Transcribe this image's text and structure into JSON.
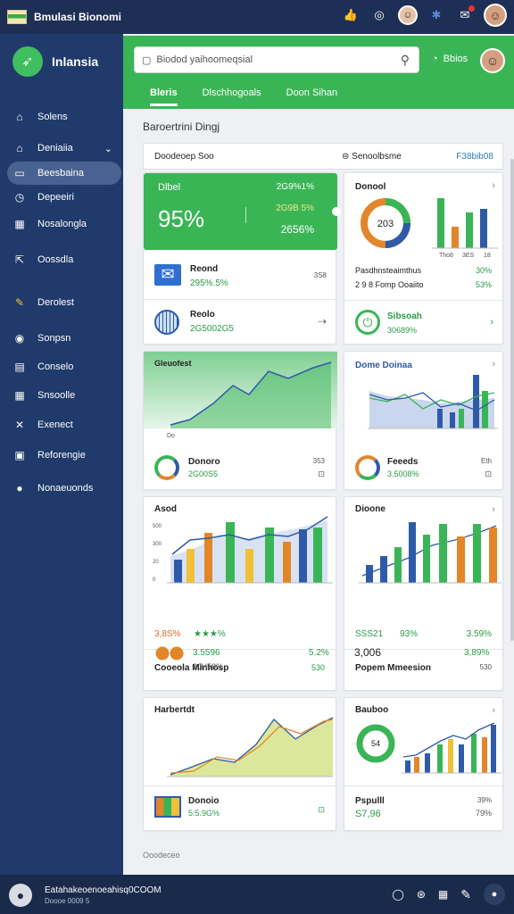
{
  "app": {
    "title": "Bmulasi Bionomi"
  },
  "topbar": {
    "icons": [
      "thumb-icon",
      "settings-icon",
      "avatar",
      "network-icon",
      "notification-icon",
      "avatar"
    ]
  },
  "sidebar": {
    "brand": "Inlansia",
    "items": [
      {
        "label": "Solens",
        "icon": "home-icon"
      },
      {
        "label": "Deniaiia",
        "icon": "chart-icon"
      },
      {
        "label": "Beesbaina",
        "icon": "folder-icon"
      },
      {
        "label": "Depeeiri",
        "icon": "clock-icon"
      },
      {
        "label": "Nosalongla",
        "icon": "grid-icon"
      },
      {
        "label": "Oossdla",
        "icon": "export-icon"
      },
      {
        "label": "Derolest",
        "icon": "pencil-icon"
      },
      {
        "label": "Sonpsn",
        "icon": "target-icon"
      },
      {
        "label": "Conselo",
        "icon": "document-icon"
      },
      {
        "label": "Snsoolle",
        "icon": "grid-icon"
      },
      {
        "label": "Exenect",
        "icon": "tools-icon"
      },
      {
        "label": "Reforengie",
        "icon": "report-icon"
      },
      {
        "label": "Nonaeuonds",
        "icon": "profile-icon"
      }
    ]
  },
  "header": {
    "search_placeholder": "Biodod yaihoomeqsial",
    "status": "Bbios",
    "tabs": [
      "Bleris",
      "Dlschhogoals",
      "Doon Sihan"
    ]
  },
  "main": {
    "section_title": "Baroertrini Dingj",
    "filter": {
      "left": "Doodeoep Soo",
      "mid": "Senoolbsme",
      "right": "F38bib08"
    }
  },
  "cards": {
    "hero": {
      "label": "Dlbel",
      "value": "95%",
      "v1": "2G9%1%",
      "v2": "2G9B 5%",
      "v3": "2656%"
    },
    "donut1": {
      "title": "Donool",
      "center": "203",
      "ticks": [
        "Tho8",
        "3ES",
        "18"
      ],
      "l1": "Pasdhnsteaimthus",
      "l2": "2 9 8 Fomp Ooaiito",
      "p1": "30%",
      "p2": "53%"
    },
    "mail": {
      "title": "Reond",
      "value": "295%.5%",
      "note": "3S8"
    },
    "globe": {
      "title": "Reolo",
      "value": "2G5002G5"
    },
    "green2": {
      "title": "Sibsoah",
      "value": "30689%"
    },
    "area1": {
      "title": "Gleuofest",
      "sub": "Donoro",
      "value": "2G00S5",
      "code": "353",
      "xtick": "Do"
    },
    "combo1": {
      "title": "Dome Doinaa",
      "sub": "Feeeds",
      "value": "3.5008%",
      "code": "Eth"
    },
    "bars1": {
      "title": "Asod",
      "value": "3,8S%",
      "stars": "★★★%",
      "ylabs": [
        "500",
        "300",
        "20",
        "0"
      ]
    },
    "bars2": {
      "title": "Dioone",
      "value": "SSS21",
      "pct": "93%",
      "pct2": "3.59%"
    },
    "list1": {
      "title": "Cooeola Minhosp",
      "code": "530",
      "value": "3.5596",
      "value2": "5.2%",
      "sub": "2JH58%"
    },
    "list2": {
      "title": "Popem Mmeesion",
      "code": "530",
      "value": "3,006",
      "value2": "3,89%"
    },
    "area2": {
      "title": "Harbertdt"
    },
    "donut2": {
      "title": "Bauboo",
      "center": "54"
    },
    "mini1": {
      "title": "Donoio",
      "value": "5:5.9G%"
    },
    "mini2": {
      "title": "Pspulll",
      "code": "39%",
      "value": "S7,96",
      "value2": "79%"
    }
  },
  "footnote": "Ooodeceo",
  "bottombar": {
    "line1": "Eatahakeoenoeahisq0COOM",
    "line2": "Doooe 0009 5"
  },
  "colors": {
    "navy": "#1f3a6b",
    "green": "#3ab556",
    "accent_blue": "#2f5aa8",
    "orange": "#e2862a",
    "yellow": "#f2c037"
  }
}
